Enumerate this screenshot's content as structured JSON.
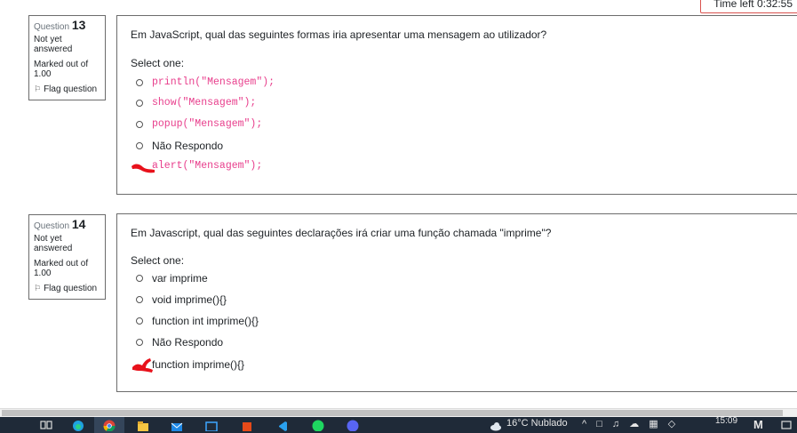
{
  "timer": {
    "label": "Time left 0:32:55"
  },
  "questions": [
    {
      "number_label": "Question",
      "number": "13",
      "state": "Not yet answered",
      "grade": "Marked out of 1.00",
      "flag_label": "Flag question",
      "text": "Em JavaScript, qual das seguintes formas iria apresentar uma mensagem ao utilizador?",
      "prompt": "Select one:",
      "options": [
        {
          "label": "println(\"Mensagem\");",
          "code": true
        },
        {
          "label": "show(\"Mensagem\");",
          "code": true
        },
        {
          "label": "popup(\"Mensagem\");",
          "code": true
        },
        {
          "label": "Não Respondo",
          "code": false
        },
        {
          "label": "alert(\"Mensagem\");",
          "code": true
        }
      ]
    },
    {
      "number_label": "Question",
      "number": "14",
      "state": "Not yet answered",
      "grade": "Marked out of 1.00",
      "flag_label": "Flag question",
      "text": "Em Javascript, qual das seguintes declarações irá criar uma função chamada \"imprime\"?",
      "prompt": "Select one:",
      "options": [
        {
          "label": "var imprime",
          "code": false
        },
        {
          "label": "void imprime(){}",
          "code": false
        },
        {
          "label": "function int imprime(){}",
          "code": false
        },
        {
          "label": "Não Respondo",
          "code": false
        },
        {
          "label": "function imprime(){}",
          "code": false
        }
      ]
    }
  ],
  "taskbar": {
    "weather": "16°C Nublado",
    "time": "15:09"
  },
  "colors": {
    "code": "#e83e8c",
    "annotation": "#e8111b",
    "taskbar": "#1f2a38"
  }
}
